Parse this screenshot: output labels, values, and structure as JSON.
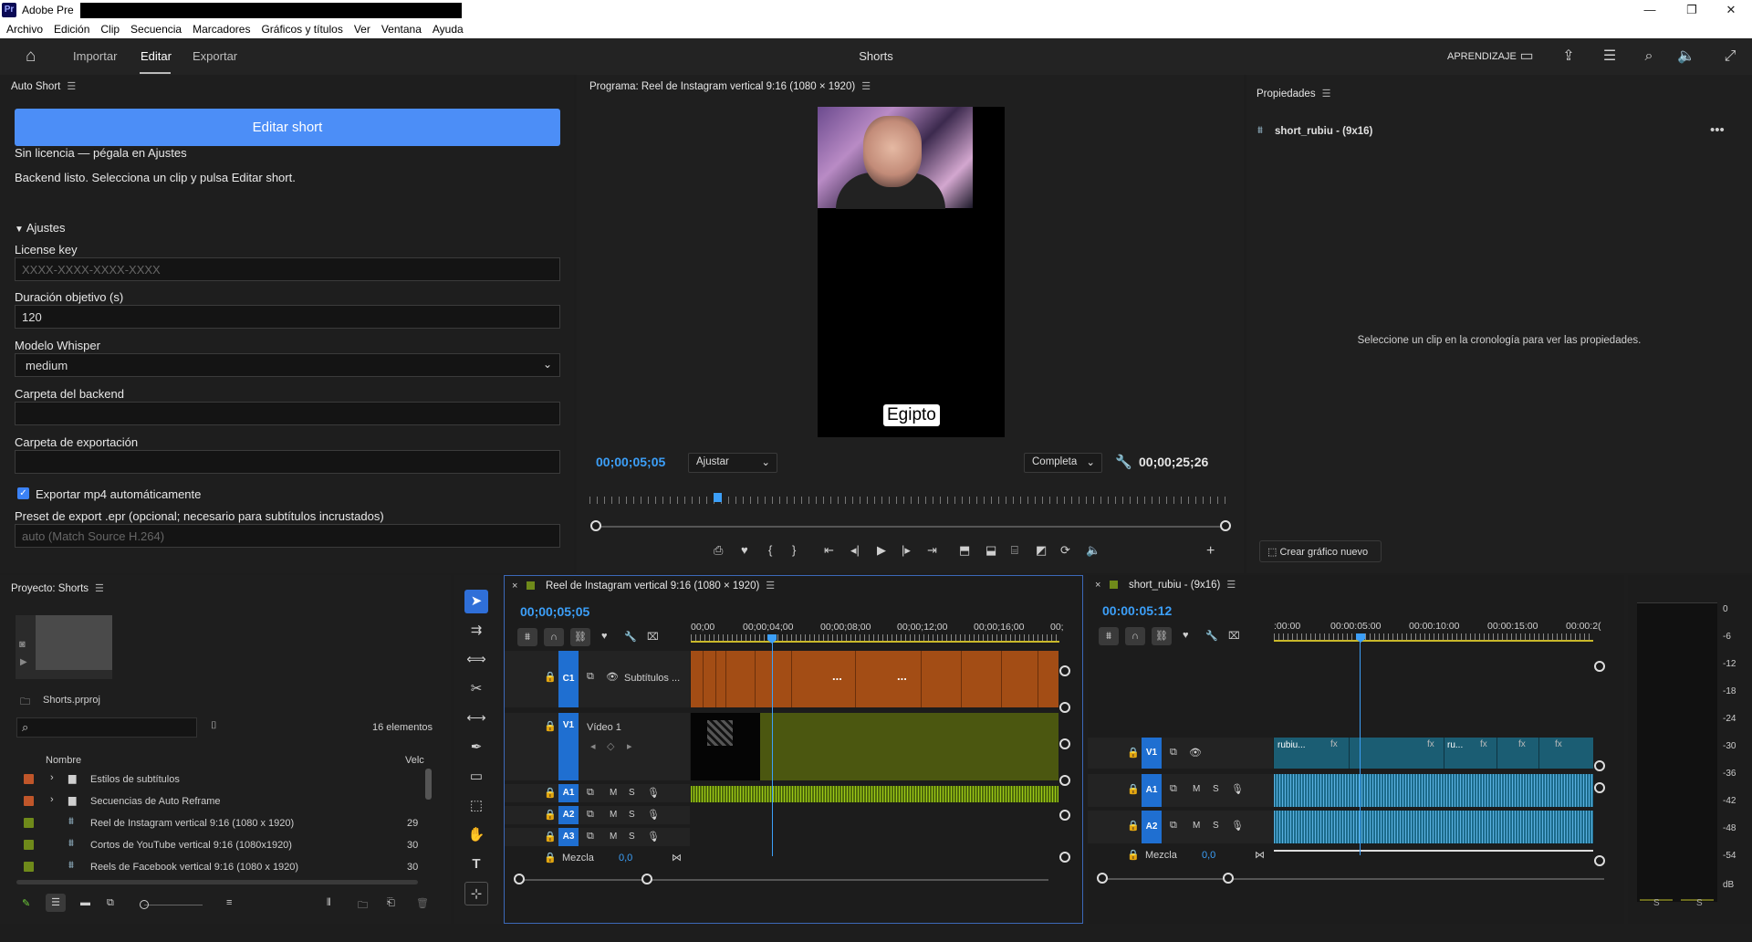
{
  "window": {
    "app_title": "Adobe Pre"
  },
  "menu": [
    "Archivo",
    "Edición",
    "Clip",
    "Secuencia",
    "Marcadores",
    "Gráficos y títulos",
    "Ver",
    "Ventana",
    "Ayuda"
  ],
  "header": {
    "home": "⌂",
    "tabs": [
      "Importar",
      "Editar",
      "Exportar"
    ],
    "active_tab": "Editar",
    "project_name": "Shorts",
    "learning": "APRENDIZAJE"
  },
  "autoshort": {
    "title": "Auto Short",
    "edit_button": "Editar short",
    "license_status": "Sin licencia — pégala en Ajustes",
    "backend_status": "Backend listo. Selecciona un clip y pulsa Editar short.",
    "settings_header": "Ajustes",
    "license_label": "License key",
    "license_placeholder": "XXXX-XXXX-XXXX-XXXX",
    "duration_label": "Duración objetivo (s)",
    "duration_value": "120",
    "whisper_label": "Modelo Whisper",
    "whisper_value": "medium",
    "backend_folder_label": "Carpeta del backend",
    "export_folder_label": "Carpeta de exportación",
    "export_mp4_label": "Exportar mp4 automáticamente",
    "preset_label": "Preset de export .epr (opcional; necesario para subtítulos incrustados)",
    "preset_placeholder": "auto (Match Source H.264)"
  },
  "program": {
    "title": "Programa: Reel de Instagram vertical 9:16 (1080 × 1920)",
    "subtitle_overlay": "Egipto",
    "timecode": "00;00;05;05",
    "fit": "Ajustar",
    "quality": "Completa",
    "duration": "00;00;25;26"
  },
  "properties": {
    "title": "Propiedades",
    "item_name": "short_rubiu - (9x16)",
    "empty_message": "Seleccione un clip en la cronología para ver las propiedades.",
    "new_graphic_button": "Crear gráfico nuevo"
  },
  "project": {
    "title": "Proyecto: Shorts",
    "file": "Shorts.prproj",
    "count": "16 elementos",
    "col_name": "Nombre",
    "col_rate": "Velc",
    "items": [
      {
        "name": "Estilos de subtítulos",
        "rate": "",
        "color": "#c0562a",
        "type": "folder"
      },
      {
        "name": "Secuencias de Auto Reframe",
        "rate": "",
        "color": "#c0562a",
        "type": "folder"
      },
      {
        "name": "Reel de Instagram vertical 9:16 (1080 x 1920)",
        "rate": "29",
        "color": "#6f8a1a",
        "type": "sequence"
      },
      {
        "name": "Cortos de YouTube vertical 9:16 (1080x1920)",
        "rate": "30",
        "color": "#6f8a1a",
        "type": "sequence"
      },
      {
        "name": "Reels de Facebook vertical 9:16 (1080 x 1920)",
        "rate": "30",
        "color": "#6f8a1a",
        "type": "sequence"
      }
    ]
  },
  "timeline1": {
    "title": "Reel de Instagram vertical 9:16 (1080 × 1920)",
    "timecode": "00;00;05;05",
    "ruler": [
      "00;00",
      "00;00;04;00",
      "00;00;08;00",
      "00;00;12;00",
      "00;00;16;00",
      "00;"
    ],
    "tracks": {
      "c1": "C1",
      "c1_name": "Subtítulos ...",
      "v1": "V1",
      "v1_name": "Vídeo 1",
      "a1": "A1",
      "a2": "A2",
      "a3": "A3",
      "m": "M",
      "s": "S"
    },
    "mix_label": "Mezcla",
    "mix_value": "0,0"
  },
  "timeline2": {
    "title": "short_rubiu - (9x16)",
    "timecode": "00:00:05:12",
    "ruler": [
      ":00:00",
      "00:00:05:00",
      "00:00:10:00",
      "00:00:15:00",
      "00:00:2("
    ],
    "clip_labels": [
      "rubiu...",
      "ru..."
    ],
    "tracks": {
      "v1": "V1",
      "a1": "A1",
      "a2": "A2",
      "m": "M",
      "s": "S"
    },
    "mix_label": "Mezcla",
    "mix_value": "0,0"
  },
  "meter": {
    "scale": [
      "0",
      "-6",
      "-12",
      "-18",
      "-24",
      "-30",
      "-36",
      "-42",
      "-48",
      "-54",
      "dB"
    ],
    "footer": [
      "S",
      "S"
    ]
  }
}
